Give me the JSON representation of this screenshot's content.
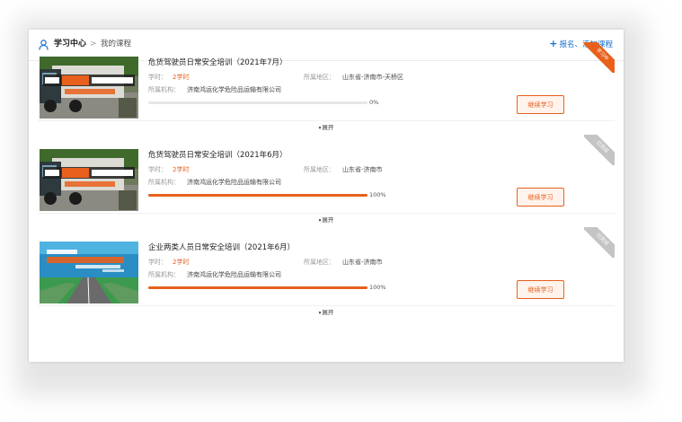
{
  "header": {
    "home": "学习中心",
    "separator": ">",
    "current": "我的课程",
    "add_link": "报名、添加课程",
    "add_icon": "+"
  },
  "labels": {
    "hours": "学时：",
    "region": "所属地区：",
    "org": "所属机构：",
    "continue": "继续学习",
    "expand": "展开",
    "expand_icon": "▾"
  },
  "courses": [
    {
      "title": "危货驾驶员日常安全培训（2021年7月）",
      "hours": "2学时",
      "region": "山东省-济南市-天桥区",
      "org": "济南鸿运化学危险品运输有限公司",
      "progress": 0,
      "progress_text": "0%",
      "status": "学习中",
      "status_color": "#e8601c",
      "thumb": "truck"
    },
    {
      "title": "危货驾驶员日常安全培训（2021年6月）",
      "hours": "2学时",
      "region": "山东省-济南市",
      "org": "济南鸿运化学危险品运输有限公司",
      "progress": 100,
      "progress_text": "100%",
      "status": "已完成",
      "status_color": "#c4c4c4",
      "thumb": "truck"
    },
    {
      "title": "企业两类人员日常安全培训（2021年6月）",
      "hours": "2学时",
      "region": "山东省-济南市",
      "org": "济南鸿运化学危险品运输有限公司",
      "progress": 100,
      "progress_text": "100%",
      "status": "已完成",
      "status_color": "#c4c4c4",
      "thumb": "road"
    }
  ],
  "colors": {
    "accent": "#e8601c",
    "link": "#1a73d1",
    "done": "#c4c4c4"
  }
}
